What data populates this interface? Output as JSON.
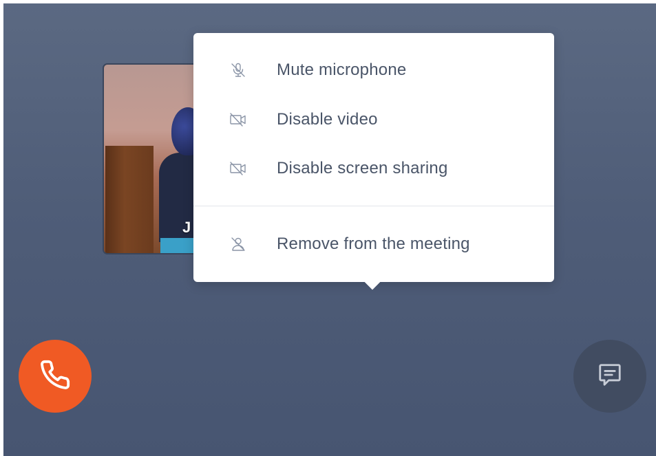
{
  "participant": {
    "initial": "J"
  },
  "menu": {
    "items": [
      {
        "label": "Mute microphone",
        "icon": "mic-off-icon"
      },
      {
        "label": "Disable video",
        "icon": "video-off-icon"
      },
      {
        "label": "Disable screen sharing",
        "icon": "screen-share-off-icon"
      },
      {
        "label": "Remove from the meeting",
        "icon": "user-remove-icon"
      }
    ]
  },
  "controls": {
    "hangup_icon": "phone-icon",
    "chat_icon": "chat-icon"
  },
  "colors": {
    "hangup": "#f05a24",
    "chat": "#414c61",
    "menu_text": "#4a5568",
    "icon_stroke": "#8a94a6"
  }
}
